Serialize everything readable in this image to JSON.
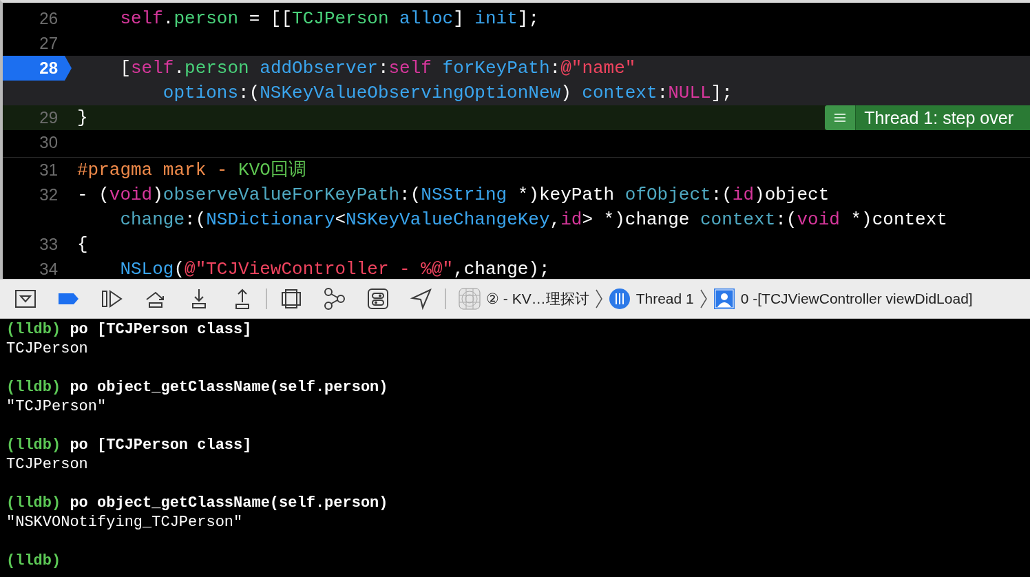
{
  "editor": {
    "lines": [
      {
        "number": "26",
        "breakpoint": false,
        "focused": false,
        "execution": false,
        "rows": [
          {
            "segments": [
              {
                "kind": "keyword",
                "text": "    self"
              },
              {
                "kind": "plain",
                "text": "."
              },
              {
                "kind": "project",
                "text": "person"
              },
              {
                "kind": "plain",
                "text": " = [["
              },
              {
                "kind": "project",
                "text": "TCJPerson"
              },
              {
                "kind": "method",
                "text": " alloc"
              },
              {
                "kind": "plain",
                "text": "] "
              },
              {
                "kind": "method",
                "text": "init"
              },
              {
                "kind": "plain",
                "text": "];"
              }
            ]
          }
        ]
      },
      {
        "number": "27",
        "breakpoint": false,
        "focused": false,
        "execution": false
      },
      {
        "number": "28",
        "breakpoint": true,
        "focused": true,
        "execution": false,
        "rows": [
          {
            "segments": [
              {
                "kind": "plain",
                "text": "    ["
              },
              {
                "kind": "keyword",
                "text": "self"
              },
              {
                "kind": "plain",
                "text": "."
              },
              {
                "kind": "project",
                "text": "person"
              },
              {
                "kind": "method",
                "text": " addObserver"
              },
              {
                "kind": "plain",
                "text": ":"
              },
              {
                "kind": "keyword",
                "text": "self"
              },
              {
                "kind": "method",
                "text": " forKeyPath"
              },
              {
                "kind": "plain",
                "text": ":"
              },
              {
                "kind": "string",
                "text": "@\"name\""
              }
            ]
          },
          {
            "segments": [
              {
                "kind": "method",
                "text": "        options"
              },
              {
                "kind": "plain",
                "text": ":("
              },
              {
                "kind": "method",
                "text": "NSKeyValueObservingOptionNew"
              },
              {
                "kind": "plain",
                "text": ") "
              },
              {
                "kind": "method",
                "text": "context"
              },
              {
                "kind": "plain",
                "text": ":"
              },
              {
                "kind": "keyword",
                "text": "NULL"
              },
              {
                "kind": "plain",
                "text": "];"
              }
            ]
          }
        ]
      },
      {
        "number": "29",
        "breakpoint": false,
        "focused": false,
        "execution": true,
        "annotation": "Thread 1: step over",
        "rows": [
          {
            "segments": [
              {
                "kind": "plain",
                "text": "}"
              }
            ]
          }
        ]
      },
      {
        "number": "30",
        "breakpoint": false,
        "focused": false,
        "execution": false
      },
      {
        "number": "31",
        "breakpoint": false,
        "focused": false,
        "execution": false,
        "rows": [
          {
            "segments": [
              {
                "kind": "preproc",
                "text": "#pragma mark - "
              },
              {
                "kind": "mark",
                "text": "KVO回调"
              }
            ]
          }
        ]
      },
      {
        "number": "32",
        "breakpoint": false,
        "focused": false,
        "execution": false,
        "rows": [
          {
            "segments": [
              {
                "kind": "plain",
                "text": "- ("
              },
              {
                "kind": "keyword",
                "text": "void"
              },
              {
                "kind": "plain",
                "text": ")"
              },
              {
                "kind": "decl",
                "text": "observeValueForKeyPath"
              },
              {
                "kind": "plain",
                "text": ":("
              },
              {
                "kind": "method",
                "text": "NSString"
              },
              {
                "kind": "plain",
                "text": " *)keyPath "
              },
              {
                "kind": "decl",
                "text": "ofObject"
              },
              {
                "kind": "plain",
                "text": ":("
              },
              {
                "kind": "keyword",
                "text": "id"
              },
              {
                "kind": "plain",
                "text": ")object"
              }
            ]
          },
          {
            "segments": [
              {
                "kind": "decl",
                "text": "    change"
              },
              {
                "kind": "plain",
                "text": ":("
              },
              {
                "kind": "method",
                "text": "NSDictionary"
              },
              {
                "kind": "plain",
                "text": "<"
              },
              {
                "kind": "method",
                "text": "NSKeyValueChangeKey"
              },
              {
                "kind": "plain",
                "text": ","
              },
              {
                "kind": "keyword",
                "text": "id"
              },
              {
                "kind": "plain",
                "text": "> *)change "
              },
              {
                "kind": "decl",
                "text": "context"
              },
              {
                "kind": "plain",
                "text": ":("
              },
              {
                "kind": "keyword",
                "text": "void"
              },
              {
                "kind": "plain",
                "text": " *)context"
              }
            ]
          }
        ]
      },
      {
        "number": "33",
        "breakpoint": false,
        "focused": false,
        "execution": false,
        "rows": [
          {
            "segments": [
              {
                "kind": "plain",
                "text": "{"
              }
            ]
          }
        ]
      },
      {
        "number": "34",
        "breakpoint": false,
        "focused": false,
        "execution": false,
        "rows": [
          {
            "segments": [
              {
                "kind": "method",
                "text": "    NSLog"
              },
              {
                "kind": "plain",
                "text": "("
              },
              {
                "kind": "string",
                "text": "@\"TCJViewController - %@\""
              },
              {
                "kind": "plain",
                "text": ",change);"
              }
            ]
          }
        ]
      }
    ]
  },
  "toolbar": {
    "breakpoints_active": true,
    "breadcrumbs": [
      {
        "kind": "app",
        "text": "② - KV…理探讨"
      },
      {
        "kind": "thread",
        "text": "Thread 1"
      },
      {
        "kind": "frame",
        "text": "0 -[TCJViewController viewDidLoad]"
      }
    ]
  },
  "console": {
    "entries": [
      {
        "prompt": "(lldb)",
        "command": "po [TCJPerson class]",
        "output": "TCJPerson"
      },
      {
        "prompt": "(lldb)",
        "command": "po object_getClassName(self.person)",
        "output": "\"TCJPerson\""
      },
      {
        "prompt": "(lldb)",
        "command": "po [TCJPerson class]",
        "output": "TCJPerson"
      },
      {
        "prompt": "(lldb)",
        "command": "po object_getClassName(self.person)",
        "output": "\"NSKVONotifying_TCJPerson\""
      },
      {
        "prompt": "(lldb)"
      }
    ]
  }
}
